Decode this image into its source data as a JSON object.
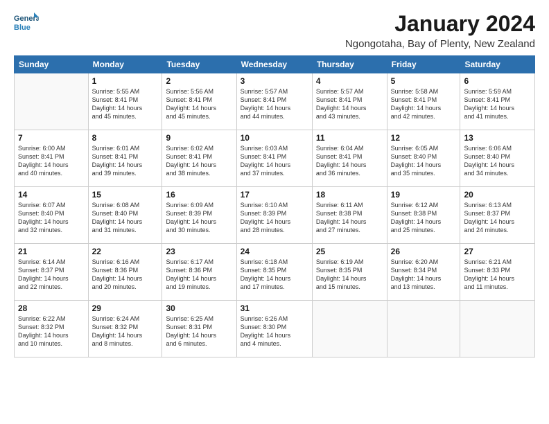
{
  "logo": {
    "line1": "General",
    "line2": "Blue"
  },
  "title": "January 2024",
  "location": "Ngongotaha, Bay of Plenty, New Zealand",
  "days_of_week": [
    "Sunday",
    "Monday",
    "Tuesday",
    "Wednesday",
    "Thursday",
    "Friday",
    "Saturday"
  ],
  "weeks": [
    [
      {
        "day": "",
        "info": ""
      },
      {
        "day": "1",
        "info": "Sunrise: 5:55 AM\nSunset: 8:41 PM\nDaylight: 14 hours\nand 45 minutes."
      },
      {
        "day": "2",
        "info": "Sunrise: 5:56 AM\nSunset: 8:41 PM\nDaylight: 14 hours\nand 45 minutes."
      },
      {
        "day": "3",
        "info": "Sunrise: 5:57 AM\nSunset: 8:41 PM\nDaylight: 14 hours\nand 44 minutes."
      },
      {
        "day": "4",
        "info": "Sunrise: 5:57 AM\nSunset: 8:41 PM\nDaylight: 14 hours\nand 43 minutes."
      },
      {
        "day": "5",
        "info": "Sunrise: 5:58 AM\nSunset: 8:41 PM\nDaylight: 14 hours\nand 42 minutes."
      },
      {
        "day": "6",
        "info": "Sunrise: 5:59 AM\nSunset: 8:41 PM\nDaylight: 14 hours\nand 41 minutes."
      }
    ],
    [
      {
        "day": "7",
        "info": "Sunrise: 6:00 AM\nSunset: 8:41 PM\nDaylight: 14 hours\nand 40 minutes."
      },
      {
        "day": "8",
        "info": "Sunrise: 6:01 AM\nSunset: 8:41 PM\nDaylight: 14 hours\nand 39 minutes."
      },
      {
        "day": "9",
        "info": "Sunrise: 6:02 AM\nSunset: 8:41 PM\nDaylight: 14 hours\nand 38 minutes."
      },
      {
        "day": "10",
        "info": "Sunrise: 6:03 AM\nSunset: 8:41 PM\nDaylight: 14 hours\nand 37 minutes."
      },
      {
        "day": "11",
        "info": "Sunrise: 6:04 AM\nSunset: 8:41 PM\nDaylight: 14 hours\nand 36 minutes."
      },
      {
        "day": "12",
        "info": "Sunrise: 6:05 AM\nSunset: 8:40 PM\nDaylight: 14 hours\nand 35 minutes."
      },
      {
        "day": "13",
        "info": "Sunrise: 6:06 AM\nSunset: 8:40 PM\nDaylight: 14 hours\nand 34 minutes."
      }
    ],
    [
      {
        "day": "14",
        "info": "Sunrise: 6:07 AM\nSunset: 8:40 PM\nDaylight: 14 hours\nand 32 minutes."
      },
      {
        "day": "15",
        "info": "Sunrise: 6:08 AM\nSunset: 8:40 PM\nDaylight: 14 hours\nand 31 minutes."
      },
      {
        "day": "16",
        "info": "Sunrise: 6:09 AM\nSunset: 8:39 PM\nDaylight: 14 hours\nand 30 minutes."
      },
      {
        "day": "17",
        "info": "Sunrise: 6:10 AM\nSunset: 8:39 PM\nDaylight: 14 hours\nand 28 minutes."
      },
      {
        "day": "18",
        "info": "Sunrise: 6:11 AM\nSunset: 8:38 PM\nDaylight: 14 hours\nand 27 minutes."
      },
      {
        "day": "19",
        "info": "Sunrise: 6:12 AM\nSunset: 8:38 PM\nDaylight: 14 hours\nand 25 minutes."
      },
      {
        "day": "20",
        "info": "Sunrise: 6:13 AM\nSunset: 8:37 PM\nDaylight: 14 hours\nand 24 minutes."
      }
    ],
    [
      {
        "day": "21",
        "info": "Sunrise: 6:14 AM\nSunset: 8:37 PM\nDaylight: 14 hours\nand 22 minutes."
      },
      {
        "day": "22",
        "info": "Sunrise: 6:16 AM\nSunset: 8:36 PM\nDaylight: 14 hours\nand 20 minutes."
      },
      {
        "day": "23",
        "info": "Sunrise: 6:17 AM\nSunset: 8:36 PM\nDaylight: 14 hours\nand 19 minutes."
      },
      {
        "day": "24",
        "info": "Sunrise: 6:18 AM\nSunset: 8:35 PM\nDaylight: 14 hours\nand 17 minutes."
      },
      {
        "day": "25",
        "info": "Sunrise: 6:19 AM\nSunset: 8:35 PM\nDaylight: 14 hours\nand 15 minutes."
      },
      {
        "day": "26",
        "info": "Sunrise: 6:20 AM\nSunset: 8:34 PM\nDaylight: 14 hours\nand 13 minutes."
      },
      {
        "day": "27",
        "info": "Sunrise: 6:21 AM\nSunset: 8:33 PM\nDaylight: 14 hours\nand 11 minutes."
      }
    ],
    [
      {
        "day": "28",
        "info": "Sunrise: 6:22 AM\nSunset: 8:32 PM\nDaylight: 14 hours\nand 10 minutes."
      },
      {
        "day": "29",
        "info": "Sunrise: 6:24 AM\nSunset: 8:32 PM\nDaylight: 14 hours\nand 8 minutes."
      },
      {
        "day": "30",
        "info": "Sunrise: 6:25 AM\nSunset: 8:31 PM\nDaylight: 14 hours\nand 6 minutes."
      },
      {
        "day": "31",
        "info": "Sunrise: 6:26 AM\nSunset: 8:30 PM\nDaylight: 14 hours\nand 4 minutes."
      },
      {
        "day": "",
        "info": ""
      },
      {
        "day": "",
        "info": ""
      },
      {
        "day": "",
        "info": ""
      }
    ]
  ]
}
